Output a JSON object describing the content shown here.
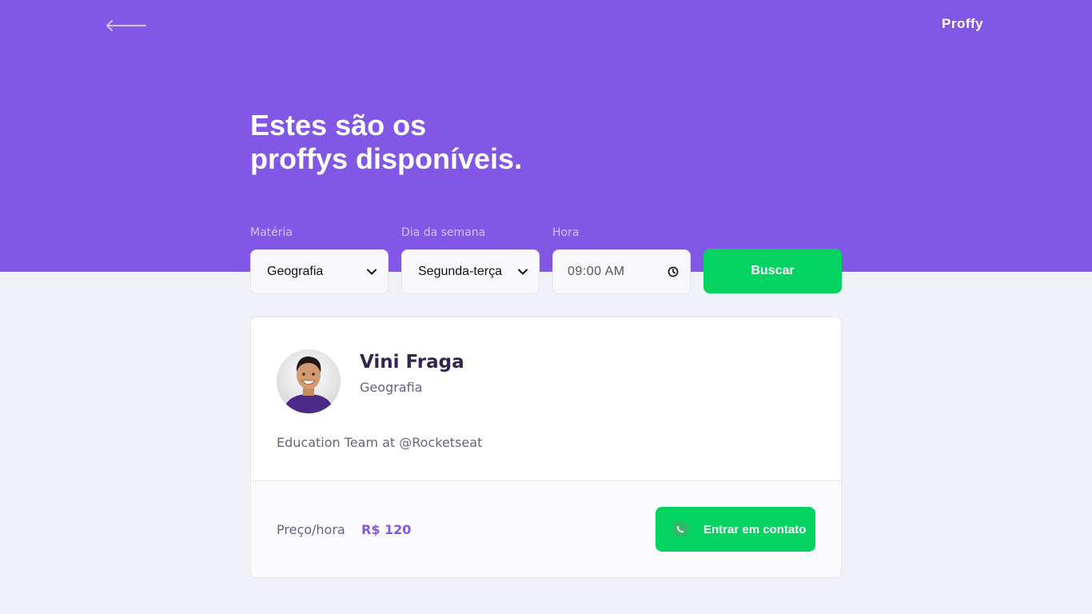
{
  "header": {
    "back_icon": "arrow-left-icon",
    "logo": "Proffy",
    "title_line1": "Estes são os",
    "title_line2": "proffys disponíveis."
  },
  "filters": {
    "subject": {
      "label": "Matéria",
      "value": "Geografia",
      "icon": "chevron-down-icon"
    },
    "weekday": {
      "label": "Dia da semana",
      "value": "Segunda-terça",
      "icon": "chevron-down-icon"
    },
    "time": {
      "label": "Hora",
      "value": "09:00 AM",
      "icon": "clock-icon"
    },
    "search_label": "Buscar"
  },
  "teacher": {
    "name": "Vini Fraga",
    "subject": "Geografia",
    "bio": "Education Team at @Rocketseat",
    "price_label": "Preço/hora",
    "price": "R$ 120",
    "contact_label": "Entrar em contato",
    "contact_icon": "whatsapp-icon"
  },
  "colors": {
    "primary": "#8257e5",
    "secondary": "#04d361",
    "background": "#f0f0f7"
  }
}
